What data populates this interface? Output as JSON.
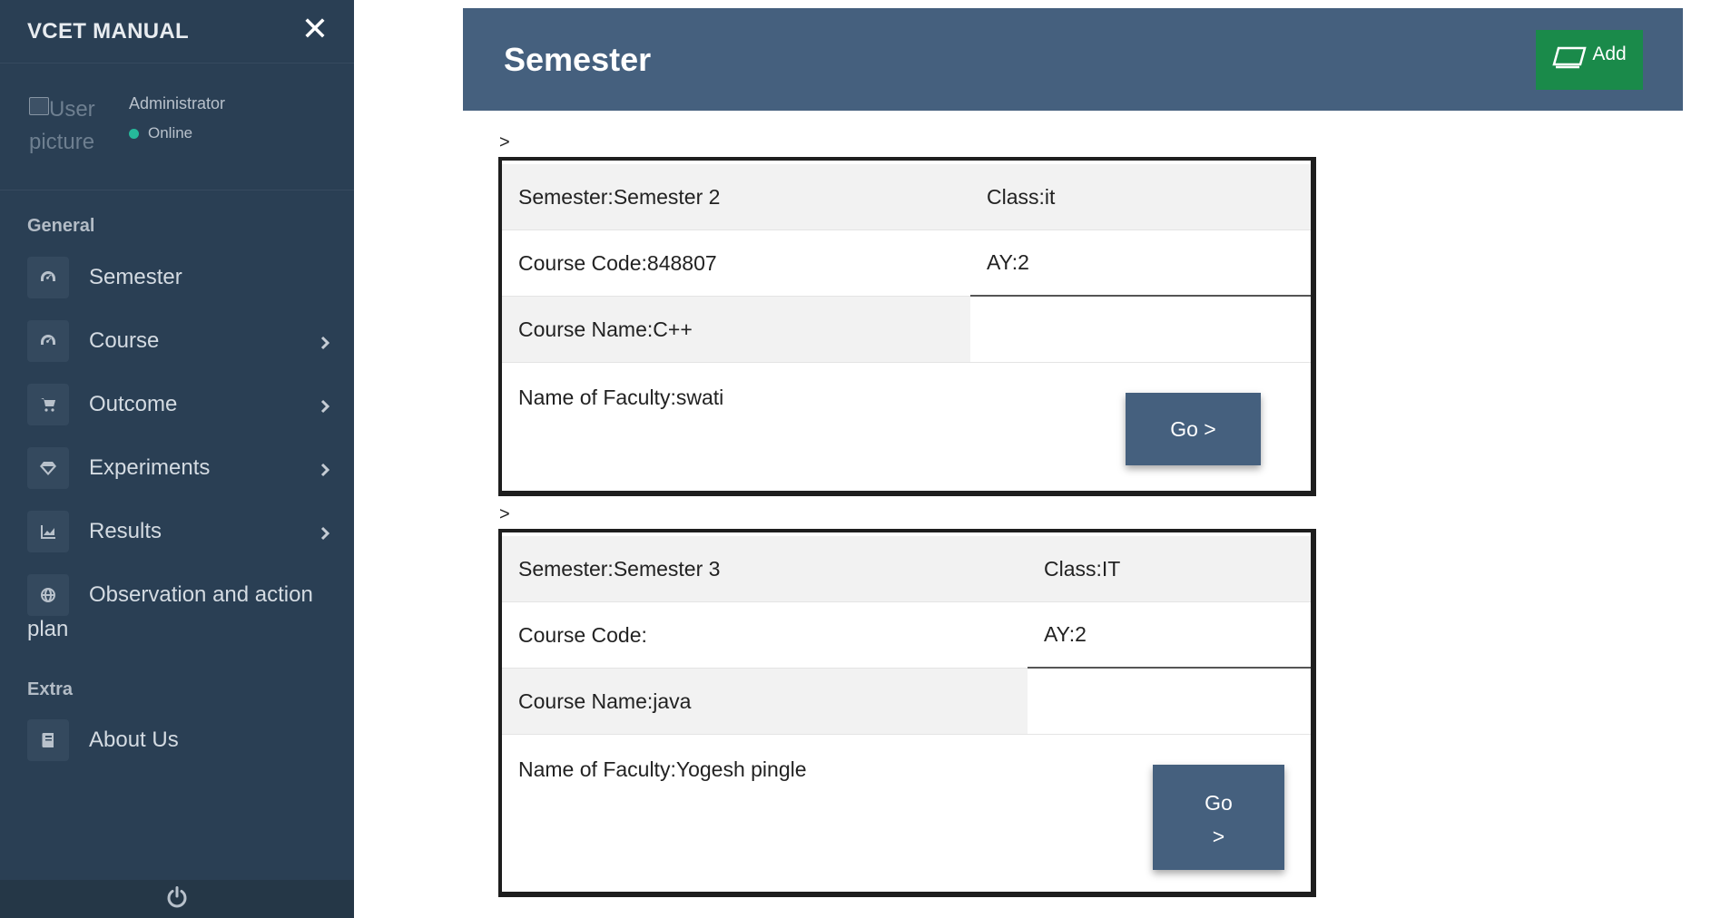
{
  "sidebar": {
    "brand": "VCET MANUAL",
    "close_glyph": "✕",
    "avatar_alt": "User picture",
    "avatar_alt_line1": "User",
    "avatar_alt_line2": "picture",
    "role": "Administrator",
    "status": "Online",
    "sections": {
      "general": "General",
      "extra": "Extra"
    },
    "items": [
      {
        "label": "Semester",
        "icon": "dashboard-icon",
        "has_submenu": false
      },
      {
        "label": "Course",
        "icon": "dashboard-icon",
        "has_submenu": true
      },
      {
        "label": "Outcome",
        "icon": "shopping-cart-icon",
        "has_submenu": true
      },
      {
        "label": "Experiments",
        "icon": "diamond-icon",
        "has_submenu": true
      },
      {
        "label": "Results",
        "icon": "area-chart-icon",
        "has_submenu": true
      },
      {
        "label": "Observation and action plan",
        "label_line1": "Observation and action",
        "label_line2": "plan",
        "icon": "globe-icon",
        "has_submenu": false
      }
    ],
    "extra_items": [
      {
        "label": "About Us",
        "icon": "book-icon",
        "has_submenu": false
      }
    ],
    "footer_icon": "power-icon"
  },
  "header": {
    "title": "Semester",
    "add_label": "Add",
    "add_icon": "tablet-icon"
  },
  "cards": [
    {
      "marker": ">",
      "semester": "Semester:Semester 2",
      "class": "Class:it",
      "course_code": "Course Code:848807",
      "ay": "AY:2",
      "course_name": "Course Name:C++",
      "faculty": "Name of Faculty:swati",
      "go_label": "Go >",
      "go_line1": "Go >",
      "go_line2": ""
    },
    {
      "marker": ">",
      "semester": "Semester:Semester 3",
      "class": "Class:IT",
      "course_code": "Course Code:",
      "ay": "AY:2",
      "course_name": "Course Name:java",
      "faculty": "Name of Faculty:Yogesh pingle",
      "go_label": "Go >",
      "go_line1": "Go",
      "go_line2": ">"
    }
  ],
  "colors": {
    "sidebar_bg": "#2a3f54",
    "header_bg": "#45607e",
    "add_button_bg": "#1a8a4a",
    "status_online": "#26b99a",
    "go_button_bg": "#45607e"
  }
}
